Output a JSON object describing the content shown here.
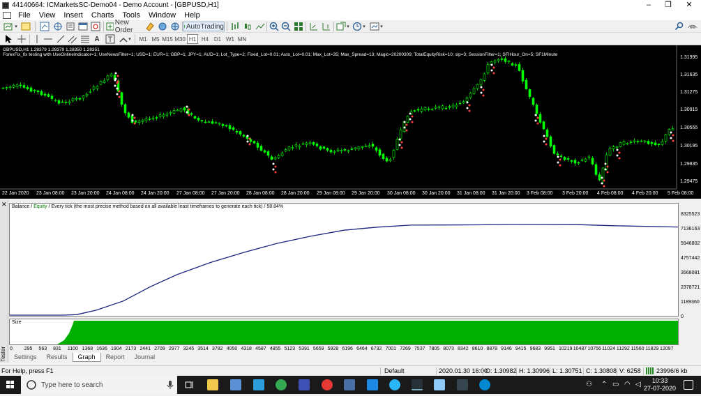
{
  "window": {
    "title": "44140664: ICMarketsSC-Demo04 - Demo Account - [GBPUSD,H1]",
    "controls": {
      "minimize": "–",
      "maximize": "❐",
      "close": "✕"
    }
  },
  "menu": {
    "items": [
      "File",
      "View",
      "Insert",
      "Charts",
      "Tools",
      "Window",
      "Help"
    ]
  },
  "toolbar": {
    "new_order": "New Order",
    "autotrading": "AutoTrading",
    "timeframes": [
      "M1",
      "M5",
      "M15",
      "M30",
      "H1",
      "H4",
      "D1",
      "W1",
      "MN"
    ],
    "active_timeframe": "H1"
  },
  "chart": {
    "symbol_line": "GBPUSD,H1  1.28379 1.28379 1.28350 1.28351",
    "ea_line": "ForexFix_fix testing with UseOnlineIndicator=1; UseNewsFilter=1; USD=1; EUR=1; GBP=1; JPY=1; AUD=1; Lot_Type=2; Fixed_Lot=0.01; Auto_Lot=0.01; Max_Lot=35; Max_Spread=13; Magic=20200309; TotalEquityRisk=10; slp=3; SessionFilter=1; SFIHour_On=5; SF1Minute",
    "price_labels": [
      "1.31995",
      "1.31635",
      "1.31275",
      "1.30915",
      "1.30555",
      "1.30195",
      "1.29835",
      "1.29475"
    ],
    "time_labels": [
      "22 Jan 2020",
      "23 Jan 08:00",
      "23 Jan 20:00",
      "24 Jan 08:00",
      "24 Jan 20:00",
      "27 Jan 08:00",
      "27 Jan 20:00",
      "28 Jan 08:00",
      "28 Jan 20:00",
      "29 Jan 08:00",
      "29 Jan 20:00",
      "30 Jan 08:00",
      "30 Jan 20:00",
      "31 Jan 08:00",
      "31 Jan 20:00",
      "3 Feb 08:00",
      "3 Feb 20:00",
      "4 Feb 08:00",
      "4 Feb 20:00",
      "5 Feb 08:00"
    ],
    "candle_color": "#00ff00",
    "background": "#000000"
  },
  "tester": {
    "close_glyph": "✕",
    "side_label": "Tester",
    "legend": {
      "balance": "Balance",
      "sep": " / ",
      "equity": "Equity",
      "rest": " / Every tick (the most precise method based on all available least timeframes to generate each tick) / 58.84%"
    },
    "y_labels": [
      "8325523",
      "7136163",
      "5946802",
      "4757442",
      "3568081",
      "2378721",
      "1189360",
      "0"
    ],
    "y_range": [
      0,
      9300000
    ],
    "size_label": "Size",
    "x_labels": [
      "0",
      "295",
      "563",
      "831",
      "1100",
      "1368",
      "1636",
      "1904",
      "2173",
      "2441",
      "2709",
      "2977",
      "3245",
      "3514",
      "3782",
      "4050",
      "4318",
      "4587",
      "4855",
      "5123",
      "5391",
      "5659",
      "5928",
      "6196",
      "6464",
      "6732",
      "7001",
      "7269",
      "7537",
      "7805",
      "8073",
      "8342",
      "8610",
      "8878",
      "9146",
      "9415",
      "9683",
      "9951",
      "10219",
      "10487",
      "10756",
      "11024",
      "11292",
      "11560",
      "11829",
      "12097"
    ],
    "tabs": [
      "Settings",
      "Results",
      "Graph",
      "Report",
      "Journal"
    ],
    "active_tab": "Graph",
    "balance_color": "#1a237e",
    "equity_color": "#008000",
    "size_color": "#00b000"
  },
  "status": {
    "help": "For Help, press F1",
    "profile": "Default",
    "datetime": "2020.01.30 16:00",
    "open": "O: 1.30982",
    "high": "H: 1.30996",
    "low": "L: 1.30751",
    "close": "C: 1.30808",
    "volume": "V: 6258",
    "traffic": "23996/6 kb"
  },
  "taskbar": {
    "search_placeholder": "Type here to search",
    "time": "10:33",
    "date": "27-07-2020"
  }
}
